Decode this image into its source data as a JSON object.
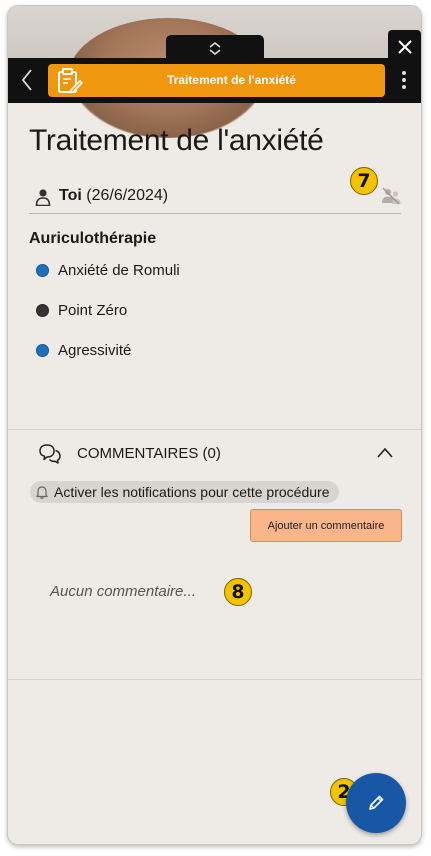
{
  "window": {
    "close_icon": "close-icon",
    "collapse_icon": "chevron-up-down-icon"
  },
  "header": {
    "back_icon": "chevron-left-icon",
    "title": "Traitement de l'anxiété",
    "procedure_icon": "clipboard-edit-icon",
    "menu_icon": "kebab-menu-icon",
    "accent_color": "#f0960f"
  },
  "main": {
    "title": "Traitement de l'anxiété",
    "author": {
      "name": "Toi",
      "date": "(26/6/2024)",
      "icon": "person-icon"
    },
    "share_icon": "share-people-icon",
    "section": {
      "title": "Auriculothérapie",
      "points": [
        {
          "label": "Anxiété de Romuli",
          "color": "#1f6fc0"
        },
        {
          "label": "Point Zéro",
          "color": "#333333"
        },
        {
          "label": "Agressivité",
          "color": "#1f6fc0"
        }
      ]
    }
  },
  "comments": {
    "title": "COMMENTAIRES (0)",
    "icon": "chat-bubbles-icon",
    "notification_label": "Activer les notifications pour cette procédure",
    "add_button": "Ajouter un commentaire",
    "empty_text": "Aucun commentaire..."
  },
  "badges": [
    "7",
    "8",
    "2"
  ],
  "fab": {
    "icon": "pencil-icon",
    "color": "#1757a6"
  }
}
